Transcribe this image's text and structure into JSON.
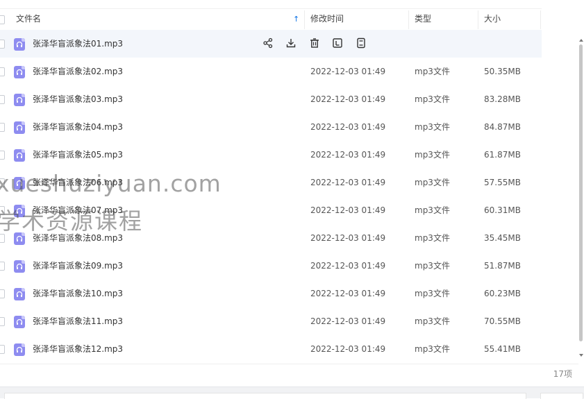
{
  "header": {
    "col_name": "文件名",
    "col_modified": "修改时间",
    "col_type": "类型",
    "col_size": "大小",
    "sort_indicator": "↑"
  },
  "row_actions": [
    "share-icon",
    "download-icon",
    "delete-icon",
    "move-icon",
    "more-icon"
  ],
  "files": [
    {
      "name": "张泽华盲派象法01.mp3",
      "modified": "",
      "type": "",
      "size": ""
    },
    {
      "name": "张泽华盲派象法02.mp3",
      "modified": "2022-12-03 01:49",
      "type": "mp3文件",
      "size": "50.35MB"
    },
    {
      "name": "张泽华盲派象法03.mp3",
      "modified": "2022-12-03 01:49",
      "type": "mp3文件",
      "size": "83.28MB"
    },
    {
      "name": "张泽华盲派象法04.mp3",
      "modified": "2022-12-03 01:49",
      "type": "mp3文件",
      "size": "84.87MB"
    },
    {
      "name": "张泽华盲派象法05.mp3",
      "modified": "2022-12-03 01:49",
      "type": "mp3文件",
      "size": "61.87MB"
    },
    {
      "name": "张泽华盲派象法06.mp3",
      "modified": "2022-12-03 01:49",
      "type": "mp3文件",
      "size": "57.55MB"
    },
    {
      "name": "张泽华盲派象法07.mp3",
      "modified": "2022-12-03 01:49",
      "type": "mp3文件",
      "size": "60.31MB"
    },
    {
      "name": "张泽华盲派象法08.mp3",
      "modified": "2022-12-03 01:49",
      "type": "mp3文件",
      "size": "35.45MB"
    },
    {
      "name": "张泽华盲派象法09.mp3",
      "modified": "2022-12-03 01:49",
      "type": "mp3文件",
      "size": "51.87MB"
    },
    {
      "name": "张泽华盲派象法10.mp3",
      "modified": "2022-12-03 01:49",
      "type": "mp3文件",
      "size": "60.23MB"
    },
    {
      "name": "张泽华盲派象法11.mp3",
      "modified": "2022-12-03 01:49",
      "type": "mp3文件",
      "size": "70.55MB"
    },
    {
      "name": "张泽华盲派象法12.mp3",
      "modified": "2022-12-03 01:49",
      "type": "mp3文件",
      "size": "55.41MB"
    }
  ],
  "footer": {
    "count": "17项"
  },
  "watermark": {
    "line1": "xueshuziyuan.com",
    "line2": "学术资源课程"
  },
  "colors": {
    "accent": "#0d73e6",
    "file_icon": "#8e8cf0",
    "hover_row": "#f3f6fb"
  }
}
